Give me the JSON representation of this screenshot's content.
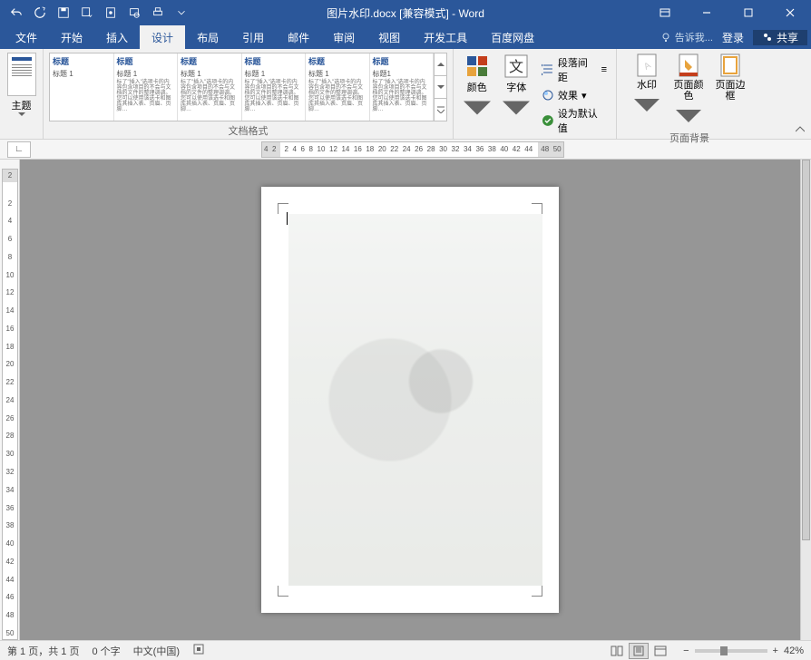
{
  "title": "图片水印.docx [兼容模式] - Word",
  "qat_icons": [
    "undo",
    "redo",
    "save",
    "save-dd",
    "touch",
    "print-preview",
    "quick-print",
    "customize"
  ],
  "window_controls": {
    "ribbon_opts": "ribbon-display-options",
    "min": "minimize",
    "max": "restore",
    "close": "close"
  },
  "tabs": [
    "文件",
    "开始",
    "插入",
    "设计",
    "布局",
    "引用",
    "邮件",
    "审阅",
    "视图",
    "开发工具",
    "百度网盘"
  ],
  "active_tab": "设计",
  "tell_me_placeholder": "告诉我...",
  "login": "登录",
  "share": "共享",
  "ribbon": {
    "theme_group": {
      "btn": "主题"
    },
    "styles_gallery_label": "文档格式",
    "style_items": [
      {
        "title": "标题",
        "sub": "标题 1"
      },
      {
        "title": "标题",
        "sub": "标题 1"
      },
      {
        "title": "标题",
        "sub": "标题 1"
      },
      {
        "title": "标题",
        "sub": "标题 1"
      },
      {
        "title": "标题",
        "sub": "标题 1"
      },
      {
        "title": "标题",
        "sub": "标题1"
      }
    ],
    "colors": "颜色",
    "fonts": "字体",
    "paragraph_spacing": "段落间距",
    "effects": "效果",
    "set_default": "设为默认值",
    "watermark": "水印",
    "page_color": "页面颜色",
    "page_borders": "页面边框",
    "page_background_label": "页面背景"
  },
  "ruler_h": [
    "4",
    "2",
    "",
    "2",
    "4",
    "6",
    "8",
    "10",
    "12",
    "14",
    "16",
    "18",
    "20",
    "22",
    "24",
    "26",
    "28",
    "30",
    "32",
    "34",
    "36",
    "38",
    "40",
    "42",
    "44",
    "",
    "48",
    "50"
  ],
  "ruler_v": [
    "2",
    "",
    "2",
    "4",
    "6",
    "8",
    "10",
    "12",
    "14",
    "16",
    "18",
    "20",
    "22",
    "24",
    "26",
    "28",
    "30",
    "32",
    "34",
    "36",
    "38",
    "40",
    "42",
    "44",
    "46",
    "48",
    "50"
  ],
  "status": {
    "page": "第 1 页，共 1 页",
    "words": "0 个字",
    "lang": "中文(中国)",
    "zoom": "42%"
  }
}
